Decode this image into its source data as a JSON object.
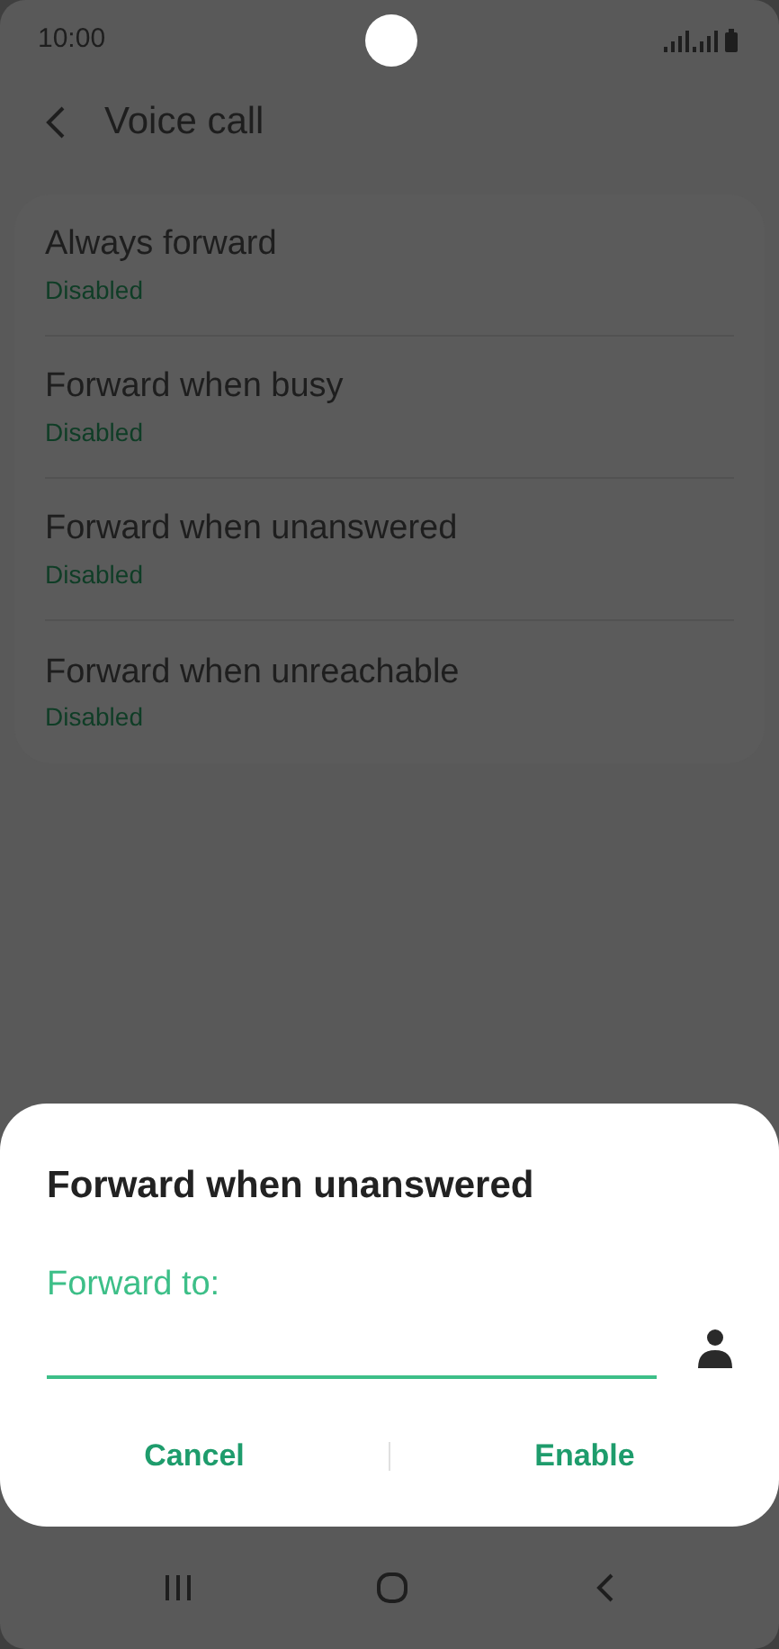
{
  "status_bar": {
    "time": "10:00"
  },
  "header": {
    "title": "Voice call"
  },
  "settings": [
    {
      "title": "Always forward",
      "status": "Disabled"
    },
    {
      "title": "Forward when busy",
      "status": "Disabled"
    },
    {
      "title": "Forward when unanswered",
      "status": "Disabled"
    },
    {
      "title": "Forward when unreachable",
      "status": "Disabled"
    }
  ],
  "dialog": {
    "title": "Forward when unanswered",
    "field_label": "Forward to:",
    "buttons": [
      "Cancel",
      "Enable"
    ]
  }
}
